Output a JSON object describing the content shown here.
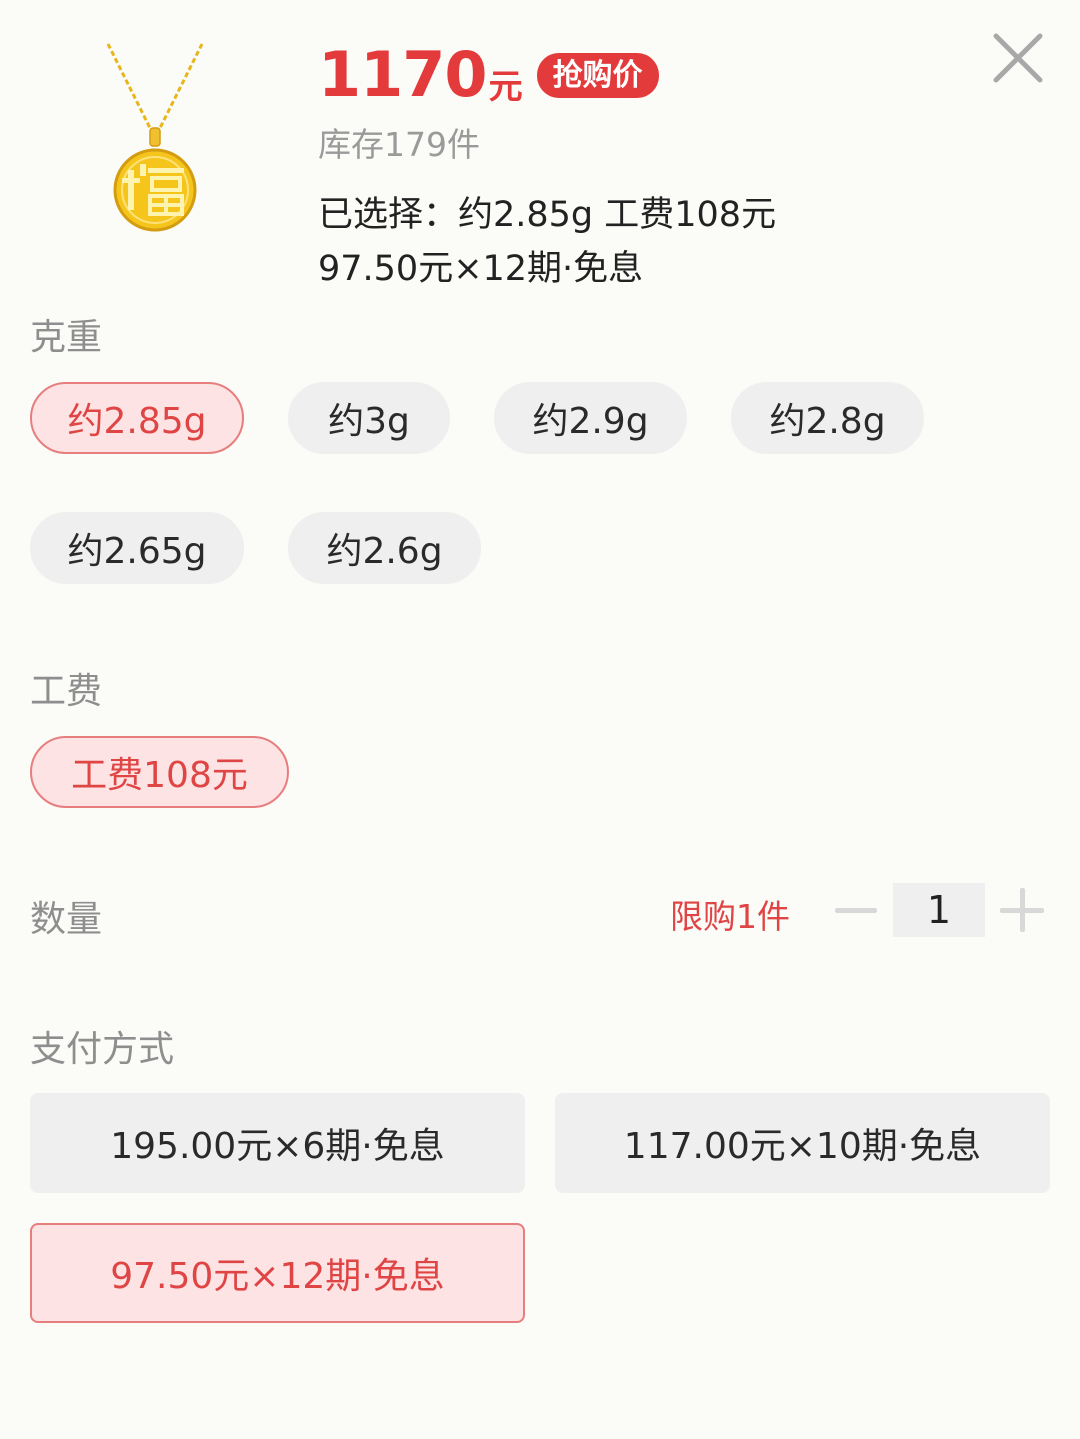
{
  "product": {
    "image_icon": "fu-gold-pendant-necklace",
    "price": "1170",
    "price_unit": "元",
    "badge": "抢购价",
    "stock": "库存179件",
    "selected": "已选择：约2.85g 工费108元",
    "installment": "97.50元×12期·免息"
  },
  "close_icon": "close-icon",
  "weight": {
    "label": "克重",
    "options": [
      "约2.85g",
      "约3g",
      "约2.9g",
      "约2.8g",
      "约2.65g",
      "约2.6g"
    ],
    "selected_index": 0
  },
  "fee": {
    "label": "工费",
    "options": [
      "工费108元"
    ],
    "selected_index": 0
  },
  "quantity": {
    "label": "数量",
    "limit": "限购1件",
    "value": "1"
  },
  "payment": {
    "label": "支付方式",
    "options": [
      "195.00元×6期·免息",
      "117.00元×10期·免息",
      "97.50元×12期·免息"
    ],
    "selected_index": 2
  },
  "colors": {
    "accent": "#e33b3b",
    "selected_bg": "#fde3e3",
    "selected_border": "#e77e7e",
    "chip_bg": "#efefef"
  }
}
